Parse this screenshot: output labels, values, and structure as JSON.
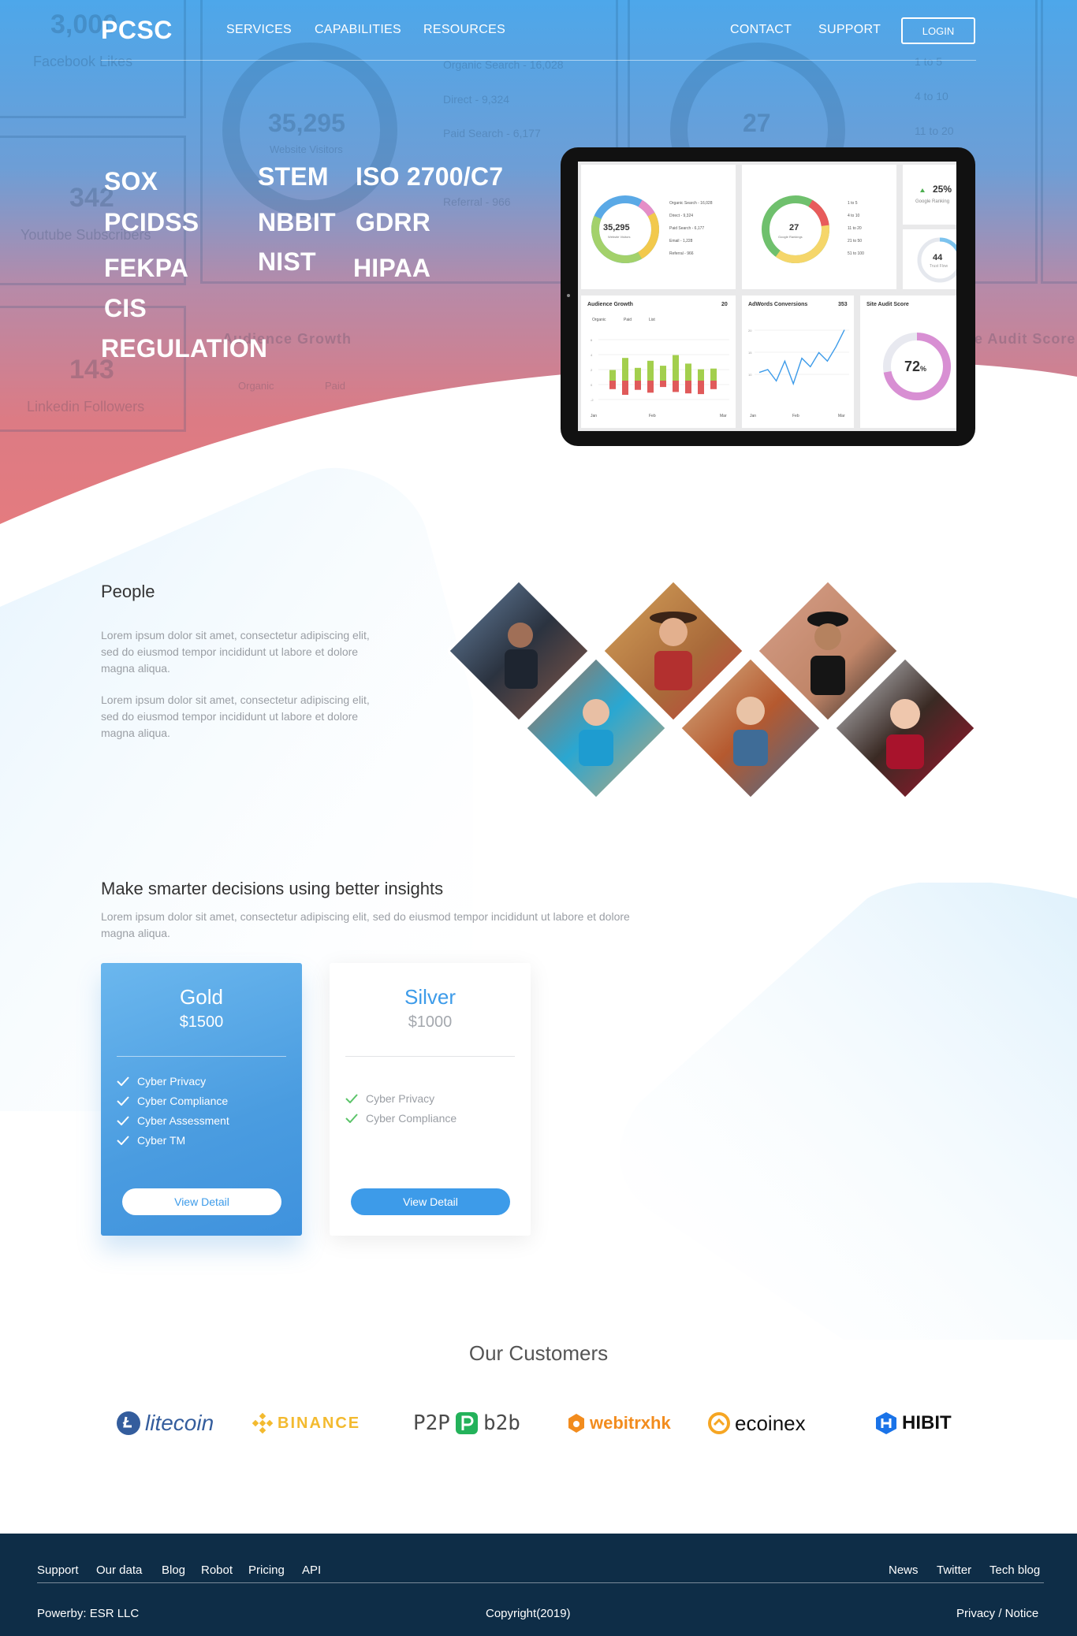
{
  "nav": {
    "logo": "PCSC",
    "items": [
      "SERVICES",
      "CAPABILITIES",
      "RESOURCES"
    ],
    "right_items": [
      "CONTACT",
      "SUPPORT"
    ],
    "login": "LOGIN"
  },
  "hero": {
    "words": [
      "SOX",
      "PCIDSS",
      "FEKPA",
      "CIS",
      "REGULATION",
      "STEM",
      "NBBIT",
      "NIST",
      "ISO 2700/C7",
      "GDRR",
      "HIPAA"
    ],
    "ghost": {
      "stats": [
        {
          "value": "3,000",
          "label": "Facebook Likes"
        },
        {
          "value": "342",
          "label": "Youtube Subscribers"
        },
        {
          "value": "143",
          "label": "Linkedin Followers"
        }
      ],
      "visitors_value": "35,295",
      "visitors_label": "Website Visitors",
      "legend": [
        "Organic Search - 16,028",
        "Direct - 9,324",
        "Paid Search - 6,177",
        "Referral - 966"
      ],
      "rank_value": "27",
      "rank_legend": [
        "1 to 5",
        "4 to 10",
        "11 to 20"
      ],
      "growth_title": "Audience Growth",
      "growth_legend": [
        "Organic",
        "Paid"
      ],
      "audit_title": "Site Audit Score"
    }
  },
  "dashboard": {
    "visitors": {
      "value": "35,295",
      "label": "Website Visitors",
      "legend": [
        "Organic Search - 16,028",
        "Direct - 9,324",
        "Paid Search - 6,177",
        "Email - 1,228",
        "Referral - 966"
      ]
    },
    "rankings": {
      "value": "27",
      "label": "Google Rankings",
      "legend": [
        "1 to 5",
        "4 to 10",
        "11 to 20",
        "21 to 50",
        "51 to 100"
      ]
    },
    "ranking_change": {
      "value": "25%",
      "label": "Google Ranking"
    },
    "trust": {
      "value": "44",
      "label": "Trust Flow"
    },
    "growth": {
      "title": "Audience Growth",
      "count": "20",
      "legend": [
        "Organic",
        "Paid",
        "List"
      ],
      "months": [
        "Jan",
        "Feb",
        "Mar"
      ],
      "ticks": [
        "6",
        "4",
        "2",
        "0",
        "-2"
      ],
      "positive": [
        1.5,
        3.2,
        1.8,
        2.8,
        2.1,
        3.6,
        2.4,
        1.6,
        1.7
      ],
      "negative": [
        1.2,
        2.0,
        1.3,
        1.7,
        0.9,
        1.6,
        1.8,
        1.9,
        1.2
      ]
    },
    "adwords": {
      "title": "AdWords Conversions",
      "count": "353",
      "months": [
        "Jan",
        "Feb",
        "Mar"
      ],
      "ticks": [
        "20",
        "15",
        "10"
      ],
      "values": [
        9,
        10,
        6,
        13,
        5,
        14,
        11,
        16,
        13,
        18,
        24
      ]
    },
    "audit": {
      "title": "Site Audit Score",
      "value": "72",
      "unit": "%",
      "percent": 72
    }
  },
  "people": {
    "title": "People",
    "p1": "Lorem ipsum dolor sit amet, consectetur adipiscing elit, sed do eiusmod tempor incididunt ut labore et dolore magna aliqua.",
    "p2": "Lorem ipsum dolor sit amet, consectetur adipiscing elit, sed do eiusmod tempor incididunt ut labore et dolore magna aliqua."
  },
  "insights": {
    "title": "Make smarter decisions using better insights",
    "text": "Lorem ipsum dolor sit amet, consectetur adipiscing elit, sed do eiusmod tempor incididunt ut labore et dolore magna aliqua."
  },
  "plans": {
    "gold": {
      "name": "Gold",
      "price": "$1500",
      "features": [
        "Cyber Privacy",
        "Cyber Compliance",
        "Cyber Assessment",
        "Cyber TM"
      ],
      "button": "View Detail"
    },
    "silver": {
      "name": "Silver",
      "price": "$1000",
      "features": [
        "Cyber Privacy",
        "Cyber Compliance"
      ],
      "button": "View Detail"
    }
  },
  "customers": {
    "title": "Our Customers",
    "brands": [
      {
        "name": "litecoin",
        "color": "#345d9d"
      },
      {
        "name": "BINANCE",
        "color": "#f3ba2f"
      },
      {
        "name": "P2P",
        "name2": "b2b",
        "color": "#4b4b4b",
        "accent": "#23b25a"
      },
      {
        "name": "webitrxhk",
        "color": "#f28c1e"
      },
      {
        "name": "ecoinex",
        "color": "#111111",
        "accent": "#f6a623"
      },
      {
        "name": "HIBIT",
        "color": "#111111",
        "accent": "#1a73e8"
      }
    ]
  },
  "footer": {
    "links": [
      "Support",
      "Our data",
      "Blog",
      "Robot",
      "Pricing",
      "API"
    ],
    "right_links": [
      "News",
      "Twitter",
      "Tech blog"
    ],
    "powered": "Powerby: ESR LLC",
    "copyright": "Copyright(2019)",
    "legal": "Privacy / Notice"
  },
  "colors": {
    "hero_top": "#4ea6e8",
    "hero_bottom": "#e07a7f",
    "accent": "#3d9be9",
    "footer": "#0e2d47",
    "check": "#5cc46a"
  }
}
